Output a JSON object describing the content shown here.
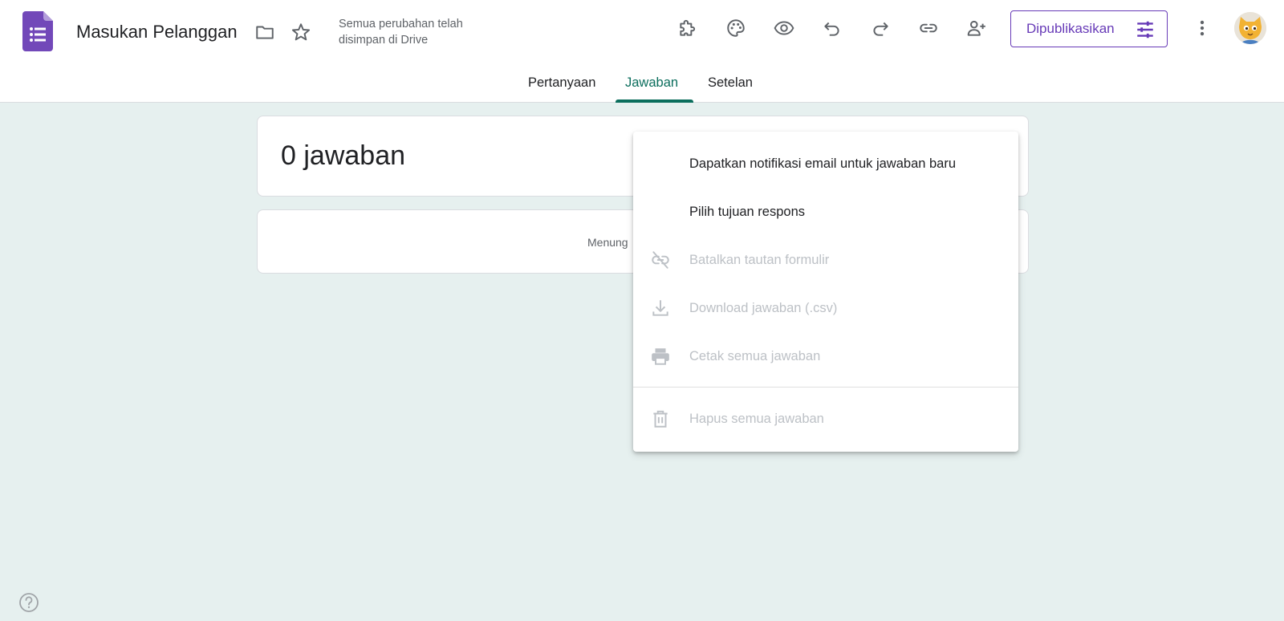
{
  "header": {
    "title": "Masukan Pelanggan",
    "save_status": "Semua perubahan telah disimpan di Drive",
    "publish_label": "Dipublikasikan",
    "icons": [
      "forms-logo-icon",
      "folder-icon",
      "star-icon",
      "addon-puzzle-icon",
      "palette-icon",
      "preview-eye-icon",
      "undo-icon",
      "redo-icon",
      "link-icon",
      "add-collaborator-icon",
      "publish-settings-icon",
      "more-vert-icon"
    ]
  },
  "tabs": [
    {
      "label": "Pertanyaan",
      "active": false
    },
    {
      "label": "Jawaban",
      "active": true
    },
    {
      "label": "Setelan",
      "active": false
    }
  ],
  "responses": {
    "count_title": "0 jawaban",
    "message_fragment": "Menung"
  },
  "menu": {
    "items": [
      {
        "label": "Dapatkan notifikasi email untuk jawaban baru",
        "enabled": true,
        "icon": ""
      },
      {
        "label": "Pilih tujuan respons",
        "enabled": true,
        "icon": ""
      },
      {
        "label": "Batalkan tautan formulir",
        "enabled": false,
        "icon": "link-off-icon"
      },
      {
        "label": "Download jawaban (.csv)",
        "enabled": false,
        "icon": "download-icon"
      },
      {
        "label": "Cetak semua jawaban",
        "enabled": false,
        "icon": "print-icon"
      },
      {
        "label": "Hapus semua jawaban",
        "enabled": false,
        "icon": "trash-icon"
      }
    ]
  },
  "colors": {
    "brand_purple": "#673ab7",
    "accent_green": "#0b6e5d",
    "page_background": "#e6f0ef",
    "disabled_text": "#bdc1c6"
  }
}
